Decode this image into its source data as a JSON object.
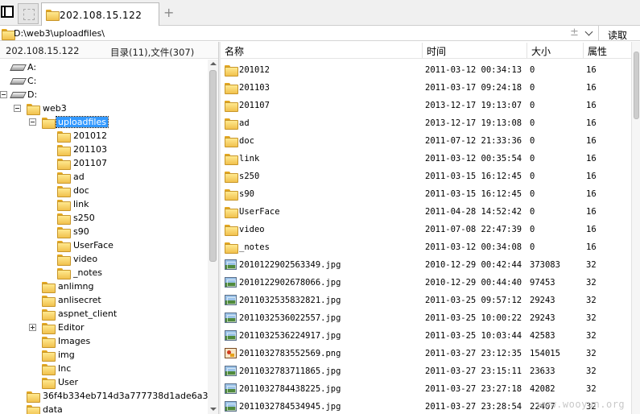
{
  "tab_bar": {
    "active_tab_label": "202.108.15.122",
    "add_tab_symbol": "+"
  },
  "address_bar": {
    "path": "D:\\web3\\uploadfiles\\",
    "nav_symbol": "±",
    "read_button": "读取"
  },
  "left_panel": {
    "host": "202.108.15.122",
    "summary": "目录(11),文件(307)",
    "tree": [
      {
        "label": "A:",
        "kind": "drive",
        "level": 0
      },
      {
        "label": "C:",
        "kind": "drive",
        "level": 0
      },
      {
        "label": "D:",
        "kind": "drive",
        "level": 0,
        "expander": "minus"
      },
      {
        "label": "web3",
        "kind": "folder",
        "level": 1,
        "expander": "minus"
      },
      {
        "label": "uploadfiles",
        "kind": "folder",
        "level": 2,
        "expander": "minus",
        "selected": true
      },
      {
        "label": "201012",
        "kind": "folder",
        "level": 3
      },
      {
        "label": "201103",
        "kind": "folder",
        "level": 3
      },
      {
        "label": "201107",
        "kind": "folder",
        "level": 3
      },
      {
        "label": "ad",
        "kind": "folder",
        "level": 3
      },
      {
        "label": "doc",
        "kind": "folder",
        "level": 3
      },
      {
        "label": "link",
        "kind": "folder",
        "level": 3
      },
      {
        "label": "s250",
        "kind": "folder",
        "level": 3
      },
      {
        "label": "s90",
        "kind": "folder",
        "level": 3
      },
      {
        "label": "UserFace",
        "kind": "folder",
        "level": 3
      },
      {
        "label": "video",
        "kind": "folder",
        "level": 3
      },
      {
        "label": "_notes",
        "kind": "folder",
        "level": 3
      },
      {
        "label": "anlimng",
        "kind": "folder",
        "level": 2
      },
      {
        "label": "anlisecret",
        "kind": "folder",
        "level": 2
      },
      {
        "label": "aspnet_client",
        "kind": "folder",
        "level": 2
      },
      {
        "label": "Editor",
        "kind": "folder",
        "level": 2,
        "expander": "plus"
      },
      {
        "label": "Images",
        "kind": "folder",
        "level": 2
      },
      {
        "label": "img",
        "kind": "folder",
        "level": 2
      },
      {
        "label": "Inc",
        "kind": "folder",
        "level": 2
      },
      {
        "label": "User",
        "kind": "folder",
        "level": 2
      },
      {
        "label": "36f4b334eb714d3a777738d1ade6a3",
        "kind": "folder",
        "level": 1
      },
      {
        "label": "data",
        "kind": "folder",
        "level": 1
      }
    ]
  },
  "file_list": {
    "columns": [
      "名称",
      "时间",
      "大小",
      "属性"
    ],
    "rows": [
      {
        "name": "201012",
        "time": "2011-03-12 00:34:13",
        "size": "0",
        "attr": "16",
        "type": "folder"
      },
      {
        "name": "201103",
        "time": "2011-03-17 09:24:18",
        "size": "0",
        "attr": "16",
        "type": "folder"
      },
      {
        "name": "201107",
        "time": "2013-12-17 19:13:07",
        "size": "0",
        "attr": "16",
        "type": "folder"
      },
      {
        "name": "ad",
        "time": "2013-12-17 19:13:08",
        "size": "0",
        "attr": "16",
        "type": "folder"
      },
      {
        "name": "doc",
        "time": "2011-07-12 21:33:36",
        "size": "0",
        "attr": "16",
        "type": "folder"
      },
      {
        "name": "link",
        "time": "2011-03-12 00:35:54",
        "size": "0",
        "attr": "16",
        "type": "folder"
      },
      {
        "name": "s250",
        "time": "2011-03-15 16:12:45",
        "size": "0",
        "attr": "16",
        "type": "folder"
      },
      {
        "name": "s90",
        "time": "2011-03-15 16:12:45",
        "size": "0",
        "attr": "16",
        "type": "folder"
      },
      {
        "name": "UserFace",
        "time": "2011-04-28 14:52:42",
        "size": "0",
        "attr": "16",
        "type": "folder"
      },
      {
        "name": "video",
        "time": "2011-07-08 22:47:39",
        "size": "0",
        "attr": "16",
        "type": "folder"
      },
      {
        "name": "_notes",
        "time": "2011-03-12 00:34:08",
        "size": "0",
        "attr": "16",
        "type": "folder"
      },
      {
        "name": "2010122902563349.jpg",
        "time": "2010-12-29 00:42:44",
        "size": "373083",
        "attr": "32",
        "type": "jpg"
      },
      {
        "name": "2010122902678066.jpg",
        "time": "2010-12-29 00:44:40",
        "size": "97453",
        "attr": "32",
        "type": "jpg"
      },
      {
        "name": "2011032535832821.jpg",
        "time": "2011-03-25 09:57:12",
        "size": "29243",
        "attr": "32",
        "type": "jpg"
      },
      {
        "name": "2011032536022557.jpg",
        "time": "2011-03-25 10:00:22",
        "size": "29243",
        "attr": "32",
        "type": "jpg"
      },
      {
        "name": "2011032536224917.jpg",
        "time": "2011-03-25 10:03:44",
        "size": "42583",
        "attr": "32",
        "type": "jpg"
      },
      {
        "name": "2011032783552569.png",
        "time": "2011-03-27 23:12:35",
        "size": "154015",
        "attr": "32",
        "type": "png"
      },
      {
        "name": "2011032783711865.jpg",
        "time": "2011-03-27 23:15:11",
        "size": "23633",
        "attr": "32",
        "type": "jpg"
      },
      {
        "name": "2011032784438225.jpg",
        "time": "2011-03-27 23:27:18",
        "size": "42082",
        "attr": "32",
        "type": "jpg"
      },
      {
        "name": "2011032784534945.jpg",
        "time": "2011-03-27 23:28:54",
        "size": "22407",
        "attr": "32",
        "type": "jpg"
      }
    ]
  },
  "watermark": "www.wooyun.org"
}
